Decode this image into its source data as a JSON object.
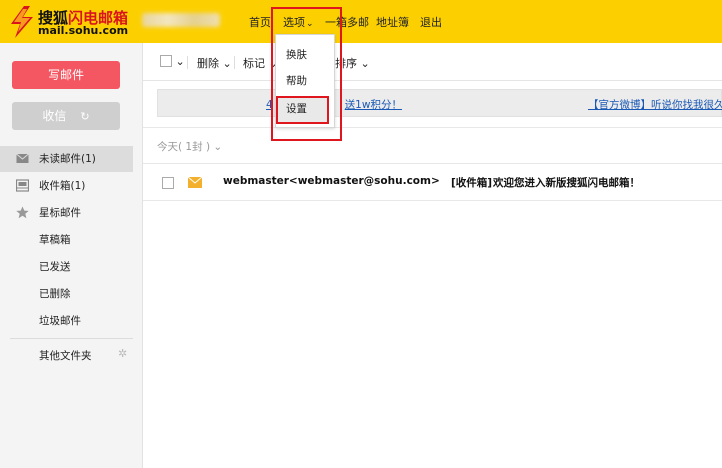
{
  "header": {
    "logo_title_part1": "搜狐",
    "logo_title_part2": "闪电邮箱",
    "logo_subtitle": "mail.sohu.com",
    "nav": {
      "home": "首页",
      "options": "选项",
      "more": "一箱多邮",
      "contacts": "地址簿",
      "logout": "退出"
    }
  },
  "options_menu": {
    "items": [
      "换肤",
      "帮助",
      "设置"
    ],
    "highlighted": "设置"
  },
  "sidebar": {
    "compose_label": "写邮件",
    "receive_label": "收信",
    "folders": [
      {
        "label": "未读邮件(1)",
        "icon": "envelope-icon",
        "active": true
      },
      {
        "label": "收件箱(1)",
        "icon": "inbox-icon",
        "active": false
      },
      {
        "label": "星标邮件",
        "icon": "star-icon",
        "active": false
      },
      {
        "label": "草稿箱",
        "icon": "",
        "active": false
      },
      {
        "label": "已发送",
        "icon": "",
        "active": false
      },
      {
        "label": "已删除",
        "icon": "",
        "active": false
      },
      {
        "label": "垃圾邮件",
        "icon": "",
        "active": false
      }
    ],
    "other_folders_label": "其他文件夹"
  },
  "toolbar": {
    "delete_label": "删除",
    "mark_label": "标记",
    "sort_label": "排序"
  },
  "notice": {
    "left_link": "送1w积分！",
    "left_prefix": "4",
    "right_link": "【官方微博】听说你找我很久了？"
  },
  "mail_list": {
    "group_label": "今天( 1封 )",
    "rows": [
      {
        "sender": "webmaster<webmaster@sohu.com>",
        "folder_tag": "[收件箱]",
        "subject": "欢迎您进入新版搜狐闪电邮箱！",
        "unread": true
      }
    ]
  },
  "colors": {
    "header_bg": "#fcd000",
    "compose_btn": "#f55762",
    "highlight_box": "#e0161e",
    "link": "#1a58b5"
  }
}
